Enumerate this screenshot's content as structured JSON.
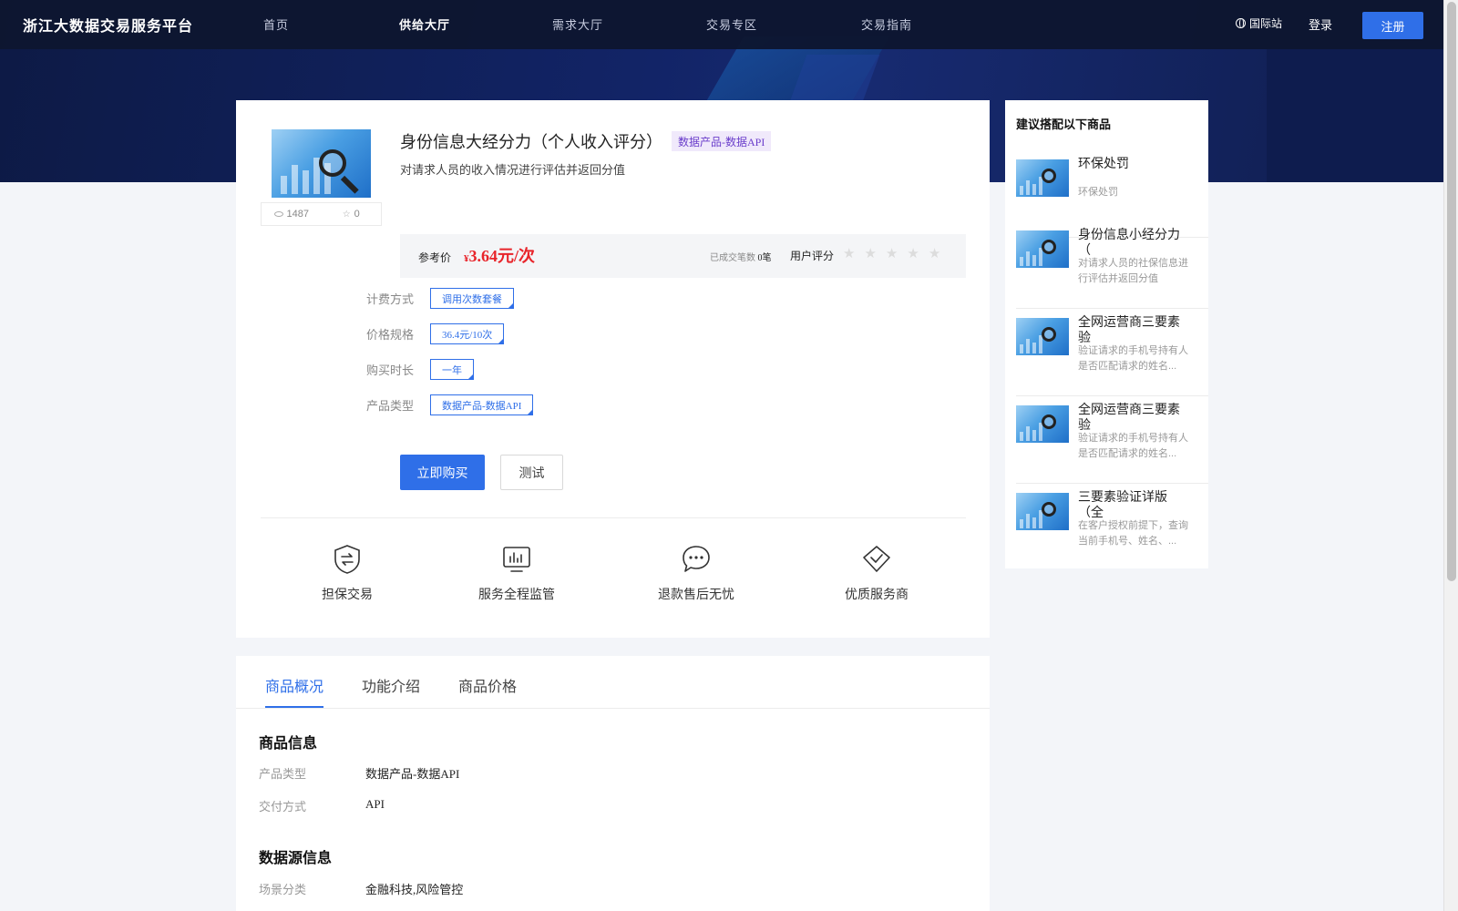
{
  "nav": {
    "logo": "浙江大数据交易服务平台",
    "items": [
      {
        "label": "首页",
        "active": false
      },
      {
        "label": "供给大厅",
        "active": true
      },
      {
        "label": "需求大厅",
        "active": false
      },
      {
        "label": "交易专区",
        "active": false
      },
      {
        "label": "交易指南",
        "active": false
      }
    ],
    "intl": "国际站",
    "login": "登录",
    "register": "注册"
  },
  "product": {
    "title": "身份信息大经分力（个人收入评分）",
    "type_tag": "数据产品-数据API",
    "description": "对请求人员的收入情况进行评估并返回分值",
    "views": "1487",
    "favorites": "0",
    "price_label": "参考价",
    "price_currency": "¥",
    "price": "3.64元/次",
    "deals_label": "已成交笔数",
    "deals_value": "0笔",
    "rating_label": "用户评分",
    "rating_stars": 0
  },
  "specs": [
    {
      "label": "计费方式",
      "option": "调用次数套餐"
    },
    {
      "label": "价格规格",
      "option": "36.4元/10次"
    },
    {
      "label": "购买时长",
      "option": "一年"
    },
    {
      "label": "产品类型",
      "option": "数据产品-数据API"
    }
  ],
  "actions": {
    "buy": "立即购买",
    "test": "测试"
  },
  "features": [
    {
      "label": "担保交易",
      "icon": "shield-exchange-icon"
    },
    {
      "label": "服务全程监管",
      "icon": "monitor-chart-icon"
    },
    {
      "label": "退款售后无忧",
      "icon": "chat-bubble-icon"
    },
    {
      "label": "优质服务商",
      "icon": "diamond-check-icon"
    }
  ],
  "tabs": [
    {
      "label": "商品概况",
      "active": true
    },
    {
      "label": "功能介绍",
      "active": false
    },
    {
      "label": "商品价格",
      "active": false
    }
  ],
  "overview": {
    "product_info_title": "商品信息",
    "product_info": [
      {
        "key": "产品类型",
        "value": "数据产品-数据API"
      },
      {
        "key": "交付方式",
        "value": "API"
      }
    ],
    "source_info_title": "数据源信息",
    "source_info": [
      {
        "key": "场景分类",
        "value": "金融科技,风险管控"
      }
    ]
  },
  "recommend": {
    "title": "建议搭配以下商品",
    "items": [
      {
        "name": "环保处罚",
        "desc": "环保处罚"
      },
      {
        "name": "身份信息小经分力（",
        "desc": "对请求人员的社保信息进行评估并返回分值"
      },
      {
        "name": "全网运营商三要素验",
        "desc": "验证请求的手机号持有人是否匹配请求的姓名..."
      },
      {
        "name": "全网运营商三要素验",
        "desc": "验证请求的手机号持有人是否匹配请求的姓名..."
      },
      {
        "name": "三要素验证详版（全",
        "desc": "在客户授权前提下，查询当前手机号、姓名、..."
      }
    ]
  },
  "colors": {
    "accent": "#2f6fe8",
    "price": "#e8242a",
    "tag_bg": "#f0e9fb",
    "tag_text": "#6a3dcb",
    "nav_bg": "#0e1630"
  }
}
